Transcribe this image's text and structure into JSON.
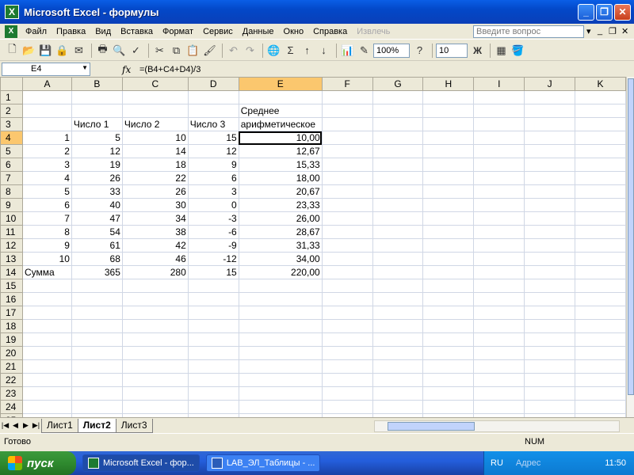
{
  "window": {
    "title": "Microsoft Excel - формулы",
    "app_icon": "excel-icon"
  },
  "menu": {
    "items": [
      "Файл",
      "Правка",
      "Вид",
      "Вставка",
      "Формат",
      "Сервис",
      "Данные",
      "Окно",
      "Справка",
      "Извлечь"
    ],
    "help_placeholder": "Введите вопрос"
  },
  "toolbar": {
    "zoom": "100%",
    "font_size": "10",
    "bold_label": "Ж"
  },
  "formula_bar": {
    "name_box": "E4",
    "fx_label": "fx",
    "formula": "=(B4+C4+D4)/3"
  },
  "grid": {
    "columns": [
      "A",
      "B",
      "C",
      "D",
      "E",
      "F",
      "G",
      "H",
      "I",
      "J",
      "K"
    ],
    "selected_column": "E",
    "selected_row": 4,
    "rows": [
      {
        "n": "1",
        "cells": [
          "",
          "",
          "",
          "",
          "",
          "",
          "",
          "",
          "",
          "",
          ""
        ]
      },
      {
        "n": "2",
        "cells": [
          "",
          "",
          "",
          "",
          "Среднее",
          "",
          "",
          "",
          "",
          "",
          ""
        ]
      },
      {
        "n": "3",
        "cells": [
          "",
          "Число 1",
          "Число 2",
          "Число 3",
          "арифметическое",
          "",
          "",
          "",
          "",
          "",
          ""
        ]
      },
      {
        "n": "4",
        "cells": [
          "1",
          "5",
          "10",
          "15",
          "10,00",
          "",
          "",
          "",
          "",
          "",
          ""
        ]
      },
      {
        "n": "5",
        "cells": [
          "2",
          "12",
          "14",
          "12",
          "12,67",
          "",
          "",
          "",
          "",
          "",
          ""
        ]
      },
      {
        "n": "6",
        "cells": [
          "3",
          "19",
          "18",
          "9",
          "15,33",
          "",
          "",
          "",
          "",
          "",
          ""
        ]
      },
      {
        "n": "7",
        "cells": [
          "4",
          "26",
          "22",
          "6",
          "18,00",
          "",
          "",
          "",
          "",
          "",
          ""
        ]
      },
      {
        "n": "8",
        "cells": [
          "5",
          "33",
          "26",
          "3",
          "20,67",
          "",
          "",
          "",
          "",
          "",
          ""
        ]
      },
      {
        "n": "9",
        "cells": [
          "6",
          "40",
          "30",
          "0",
          "23,33",
          "",
          "",
          "",
          "",
          "",
          ""
        ]
      },
      {
        "n": "10",
        "cells": [
          "7",
          "47",
          "34",
          "-3",
          "26,00",
          "",
          "",
          "",
          "",
          "",
          ""
        ]
      },
      {
        "n": "11",
        "cells": [
          "8",
          "54",
          "38",
          "-6",
          "28,67",
          "",
          "",
          "",
          "",
          "",
          ""
        ]
      },
      {
        "n": "12",
        "cells": [
          "9",
          "61",
          "42",
          "-9",
          "31,33",
          "",
          "",
          "",
          "",
          "",
          ""
        ]
      },
      {
        "n": "13",
        "cells": [
          "10",
          "68",
          "46",
          "-12",
          "34,00",
          "",
          "",
          "",
          "",
          "",
          ""
        ]
      },
      {
        "n": "14",
        "cells": [
          "Сумма",
          "365",
          "280",
          "15",
          "220,00",
          "",
          "",
          "",
          "",
          "",
          ""
        ]
      },
      {
        "n": "15",
        "cells": [
          "",
          "",
          "",
          "",
          "",
          "",
          "",
          "",
          "",
          "",
          ""
        ]
      },
      {
        "n": "16",
        "cells": [
          "",
          "",
          "",
          "",
          "",
          "",
          "",
          "",
          "",
          "",
          ""
        ]
      },
      {
        "n": "17",
        "cells": [
          "",
          "",
          "",
          "",
          "",
          "",
          "",
          "",
          "",
          "",
          ""
        ]
      },
      {
        "n": "18",
        "cells": [
          "",
          "",
          "",
          "",
          "",
          "",
          "",
          "",
          "",
          "",
          ""
        ]
      },
      {
        "n": "19",
        "cells": [
          "",
          "",
          "",
          "",
          "",
          "",
          "",
          "",
          "",
          "",
          ""
        ]
      },
      {
        "n": "20",
        "cells": [
          "",
          "",
          "",
          "",
          "",
          "",
          "",
          "",
          "",
          "",
          ""
        ]
      },
      {
        "n": "21",
        "cells": [
          "",
          "",
          "",
          "",
          "",
          "",
          "",
          "",
          "",
          "",
          ""
        ]
      },
      {
        "n": "22",
        "cells": [
          "",
          "",
          "",
          "",
          "",
          "",
          "",
          "",
          "",
          "",
          ""
        ]
      },
      {
        "n": "23",
        "cells": [
          "",
          "",
          "",
          "",
          "",
          "",
          "",
          "",
          "",
          "",
          ""
        ]
      },
      {
        "n": "24",
        "cells": [
          "",
          "",
          "",
          "",
          "",
          "",
          "",
          "",
          "",
          "",
          ""
        ]
      },
      {
        "n": "25",
        "cells": [
          "",
          "",
          "",
          "",
          "",
          "",
          "",
          "",
          "",
          "",
          ""
        ]
      }
    ]
  },
  "sheets": {
    "tabs": [
      "Лист1",
      "Лист2",
      "Лист3"
    ],
    "active": "Лист2"
  },
  "status": {
    "text": "Готово",
    "indicator": "NUM"
  },
  "taskbar": {
    "start_label": "пуск",
    "items": [
      "Microsoft Excel - фор...",
      "LAB_ЭЛ_Таблицы - ..."
    ],
    "language": "RU",
    "address_label": "Адрес",
    "clock": "11:50"
  }
}
